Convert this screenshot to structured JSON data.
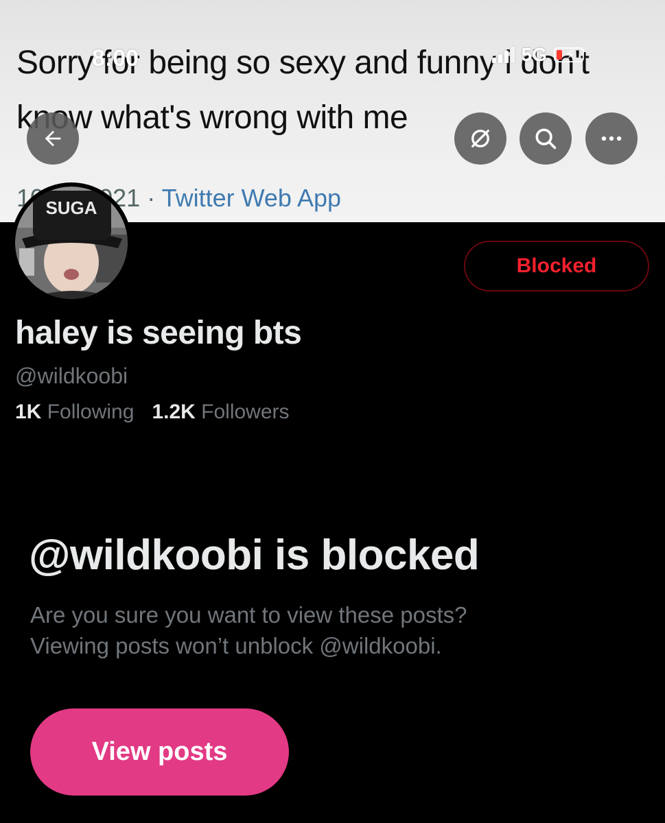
{
  "colors": {
    "background": "#000000",
    "blocked_red": "#f4212e",
    "blocked_border": "#67070f",
    "view_posts_pink": "#e23a84",
    "secondary_text": "#71767b",
    "primary_text": "#e7e9ea"
  },
  "status_bar": {
    "time": "8:00",
    "network": "5G",
    "icons": [
      "signal-icon",
      "battery-charging-icon"
    ]
  },
  "header": {
    "banner": {
      "tweet_text": "Sorry for being so sexy and funny i don't know what's wrong with me",
      "date": "10/03/2021",
      "separator": "·",
      "source": "Twitter Web App"
    },
    "buttons": {
      "back_icon": "arrow-left-icon",
      "grok_icon": "grok-icon",
      "search_icon": "search-icon",
      "more_icon": "more-icon"
    }
  },
  "profile": {
    "avatar_text": "SUGA",
    "blocked_label": "Blocked",
    "display_name": "haley is seeing bts",
    "handle": "@wildkoobi",
    "following_count": "1K",
    "following_label": "Following",
    "followers_count": "1.2K",
    "followers_label": "Followers"
  },
  "blocked_notice": {
    "title": "@wildkoobi is blocked",
    "line1": "Are you sure you want to view these posts?",
    "line2": "Viewing posts won’t unblock @wildkoobi.",
    "button_label": "View posts"
  }
}
